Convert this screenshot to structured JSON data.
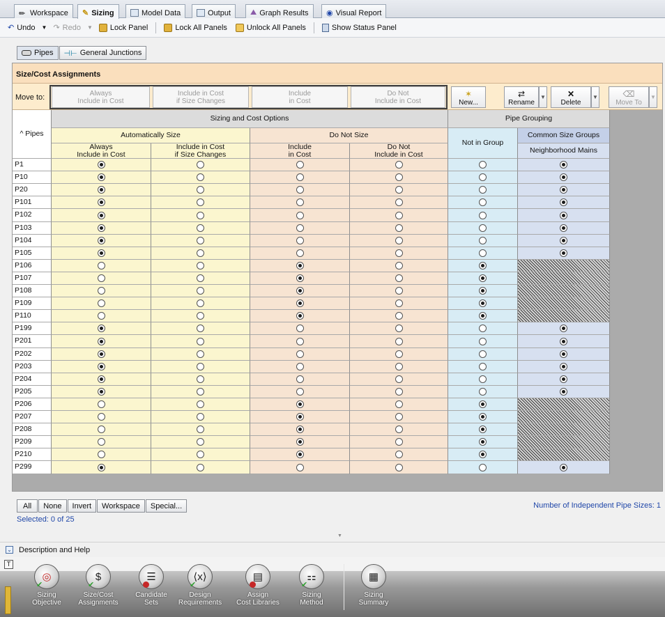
{
  "tabs": [
    {
      "label": "Workspace",
      "icon": "workspace-icon"
    },
    {
      "label": "Sizing",
      "icon": "sizing-icon",
      "active": true
    },
    {
      "label": "Model Data",
      "icon": "model-data-icon"
    },
    {
      "label": "Output",
      "icon": "output-icon"
    },
    {
      "label": "Graph Results",
      "icon": "graph-icon"
    },
    {
      "label": "Visual Report",
      "icon": "eye-icon"
    }
  ],
  "toolbar": {
    "undo": "Undo",
    "redo": "Redo",
    "lock_panel": "Lock Panel",
    "lock_all": "Lock All Panels",
    "unlock_all": "Unlock All Panels",
    "status_panel": "Show Status Panel"
  },
  "subtabs": {
    "pipes": "Pipes",
    "junctions": "General Junctions"
  },
  "panel": {
    "title": "Size/Cost Assignments",
    "move_to_label": "Move to:",
    "move_buttons": [
      {
        "line1": "Always",
        "line2": "Include in Cost"
      },
      {
        "line1": "Include in Cost",
        "line2": "if Size Changes"
      },
      {
        "line1": "Include",
        "line2": "in Cost"
      },
      {
        "line1": "Do Not",
        "line2": "Include in Cost"
      }
    ],
    "group_buttons": {
      "new": "New...",
      "rename": "Rename",
      "delete": "Delete",
      "move_to": "Move To"
    }
  },
  "grid": {
    "pipes_header": "^ Pipes",
    "sizing_cost_header": "Sizing and Cost Options",
    "pipe_grouping_header": "Pipe Grouping",
    "auto_size": "Automatically Size",
    "do_not_size": "Do Not Size",
    "not_in_group": "Not in Group",
    "common_size_groups": "Common Size Groups",
    "neighborhood_mains": "Neighborhood Mains",
    "col_headers": [
      {
        "line1": "Always",
        "line2": "Include in Cost"
      },
      {
        "line1": "Include in Cost",
        "line2": "if Size Changes"
      },
      {
        "line1": "Include",
        "line2": "in Cost"
      },
      {
        "line1": "Do Not",
        "line2": "Include in Cost"
      }
    ],
    "rows": [
      {
        "name": "P1",
        "option": 0,
        "group": "nm"
      },
      {
        "name": "P10",
        "option": 0,
        "group": "nm"
      },
      {
        "name": "P20",
        "option": 0,
        "group": "nm"
      },
      {
        "name": "P101",
        "option": 0,
        "group": "nm"
      },
      {
        "name": "P102",
        "option": 0,
        "group": "nm"
      },
      {
        "name": "P103",
        "option": 0,
        "group": "nm"
      },
      {
        "name": "P104",
        "option": 0,
        "group": "nm"
      },
      {
        "name": "P105",
        "option": 0,
        "group": "nm"
      },
      {
        "name": "P106",
        "option": 2,
        "group": "none"
      },
      {
        "name": "P107",
        "option": 2,
        "group": "none"
      },
      {
        "name": "P108",
        "option": 2,
        "group": "none"
      },
      {
        "name": "P109",
        "option": 2,
        "group": "none"
      },
      {
        "name": "P110",
        "option": 2,
        "group": "none"
      },
      {
        "name": "P199",
        "option": 0,
        "group": "nm"
      },
      {
        "name": "P201",
        "option": 0,
        "group": "nm"
      },
      {
        "name": "P202",
        "option": 0,
        "group": "nm"
      },
      {
        "name": "P203",
        "option": 0,
        "group": "nm"
      },
      {
        "name": "P204",
        "option": 0,
        "group": "nm"
      },
      {
        "name": "P205",
        "option": 0,
        "group": "nm"
      },
      {
        "name": "P206",
        "option": 2,
        "group": "none"
      },
      {
        "name": "P207",
        "option": 2,
        "group": "none"
      },
      {
        "name": "P208",
        "option": 2,
        "group": "none"
      },
      {
        "name": "P209",
        "option": 2,
        "group": "none"
      },
      {
        "name": "P210",
        "option": 2,
        "group": "none"
      },
      {
        "name": "P299",
        "option": 0,
        "group": "nm"
      }
    ]
  },
  "selection": {
    "buttons": [
      "All",
      "None",
      "Invert",
      "Workspace",
      "Special..."
    ],
    "selected_text": "Selected: 0 of 25",
    "independent_sizes": "Number of Independent Pipe Sizes: 1"
  },
  "description_help": "Description and Help",
  "nav": [
    {
      "line1": "Sizing",
      "line2": "Objective",
      "icon": "target-icon",
      "status": "ok"
    },
    {
      "line1": "Size/Cost",
      "line2": "Assignments",
      "icon": "ruler-dollar-icon",
      "status": "ok"
    },
    {
      "line1": "Candidate",
      "line2": "Sets",
      "icon": "candidate-sets-icon",
      "status": "warn"
    },
    {
      "line1": "Design",
      "line2": "Requirements",
      "icon": "variable-x-icon",
      "status": "ok"
    },
    {
      "line1": "Assign",
      "line2": "Cost Libraries",
      "icon": "cost-library-icon",
      "status": "warn"
    },
    {
      "line1": "Sizing",
      "line2": "Method",
      "icon": "flowchart-icon",
      "status": "ok"
    },
    {
      "line1": "Sizing",
      "line2": "Summary",
      "icon": "summary-icon",
      "status": "none"
    }
  ],
  "colors": {
    "auto_size": "#fbf6cf",
    "do_not_size": "#f7e4d2",
    "not_in_group": "#d8ecf5",
    "group": "#d7e0f0",
    "panel_title": "#fadfbd"
  }
}
